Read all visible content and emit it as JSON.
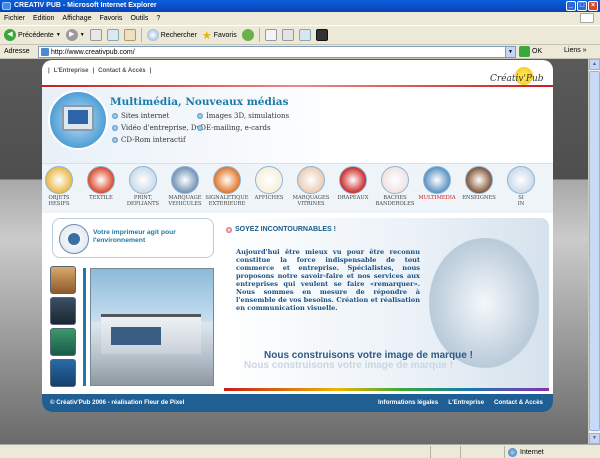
{
  "window": {
    "title": "CREATIV PUB - Microsoft Internet Explorer"
  },
  "menu": [
    "Fichier",
    "Edition",
    "Affichage",
    "Favoris",
    "Outils",
    "?"
  ],
  "toolbar": {
    "back": "Précédente",
    "search": "Rechercher",
    "favorites": "Favoris"
  },
  "address": {
    "label": "Adresse",
    "url": "http://www.creativpub.com/",
    "go": "OK",
    "links": "Liens"
  },
  "site": {
    "nav": [
      "L'Entreprise",
      "Contact & Accès"
    ],
    "logo": "Créativ'Pub",
    "banner_title": "Multimédia, Nouveaux médias",
    "services": [
      "Sites internet",
      "Images 3D, simulations",
      "Vidéo d'entreprise, DvD",
      "E-mailing, e-cards",
      "CD-Rom interactif"
    ],
    "categories": [
      {
        "label": "OBJETS\nHESIFS",
        "color": "#e8b43a"
      },
      {
        "label": "TEXTILE",
        "color": "#d93b1c"
      },
      {
        "label": "PRINT,\nDEPLIANTS",
        "color": "#c8d8e8"
      },
      {
        "label": "MARQUAGE\nVEHICULES",
        "color": "#6a8cb0"
      },
      {
        "label": "SIGNALETIQUE\nEXTERIEURE",
        "color": "#e06d1a"
      },
      {
        "label": "AFFICHES",
        "color": "#f5efd8"
      },
      {
        "label": "MARQUAGES\nVITRINES",
        "color": "#e8c9b0"
      },
      {
        "label": "DRAPEAUX",
        "color": "#c81c1c"
      },
      {
        "label": "BACHES\nBANDEROLES",
        "color": "#f0e0e0"
      },
      {
        "label": "MULTIMEDIA",
        "color": "#4f8bc0"
      },
      {
        "label": "ENSEIGNES",
        "color": "#7a4a2a"
      },
      {
        "label": "SI\nIN",
        "color": "#c8d8e8"
      }
    ],
    "bubble": "Votre imprimeur agit pour l'environnement",
    "section_title": "SOYEZ INCONTOURNABLES !",
    "paragraph": "Aujourd'hui être mieux vu pour être reconnu constitue la force indispensable de tout commerce et entreprise. Spécialistes, nous proposons notre savoir-faire et nos services aux entreprises qui veulent se faire «remarquer». Nous sommes en mesure de répondre à l'ensemble de vos besoins. Création et réalisation en communication visuelle.",
    "slogan": "Nous construisons votre image de marque !",
    "footer_copy": "© Créativ'Pub 2006 - réalisation Fleur de Pixel",
    "footer_links": [
      "Informations légales",
      "L'Entreprise",
      "Contact & Accès"
    ]
  },
  "status": {
    "zone": "Internet"
  }
}
